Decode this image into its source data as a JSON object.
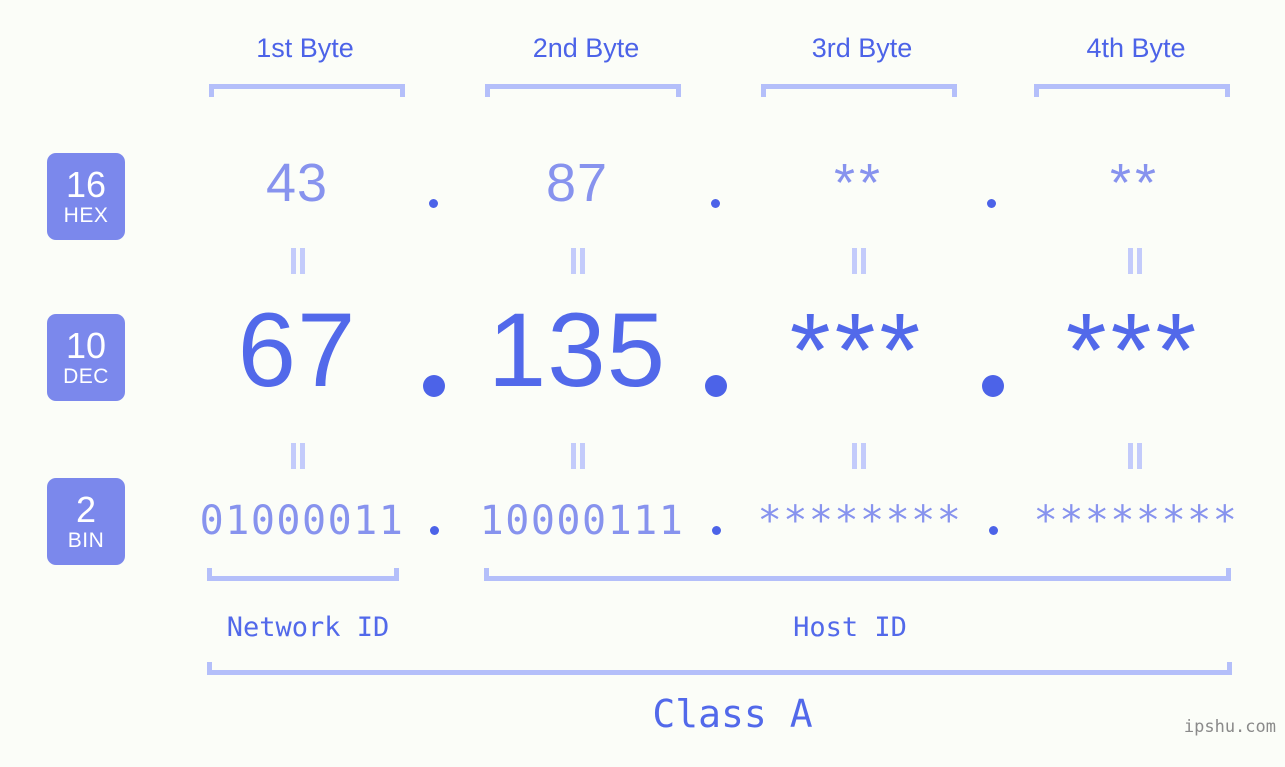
{
  "background_color": "#fbfdf8",
  "accent_dark": "#4c63e8",
  "accent_mid": "#5269ea",
  "accent_light": "#8793ee",
  "accent_pale": "#b4bffa",
  "badge_bg": "#7b88ec",
  "header": {
    "bytes": [
      {
        "label": "1st Byte"
      },
      {
        "label": "2nd Byte"
      },
      {
        "label": "3rd Byte"
      },
      {
        "label": "4th Byte"
      }
    ]
  },
  "radix": [
    {
      "num": "16",
      "name": "HEX"
    },
    {
      "num": "10",
      "name": "DEC"
    },
    {
      "num": "2",
      "name": "BIN"
    }
  ],
  "rows": {
    "hex": {
      "values": [
        "43",
        "87",
        "**",
        "**"
      ],
      "separator": "."
    },
    "dec": {
      "values": [
        "67",
        "135",
        "***",
        "***"
      ],
      "separator": "."
    },
    "bin": {
      "values": [
        "01000011",
        "10000111",
        "********",
        "********"
      ],
      "separator": "."
    }
  },
  "equals_marks": {
    "glyph": "=",
    "count_per_row": 4,
    "rows": 2
  },
  "regions": [
    {
      "label": "Network ID"
    },
    {
      "label": "Host ID"
    }
  ],
  "class": {
    "label": "Class A"
  },
  "watermark": {
    "text": "ipshu.com"
  }
}
